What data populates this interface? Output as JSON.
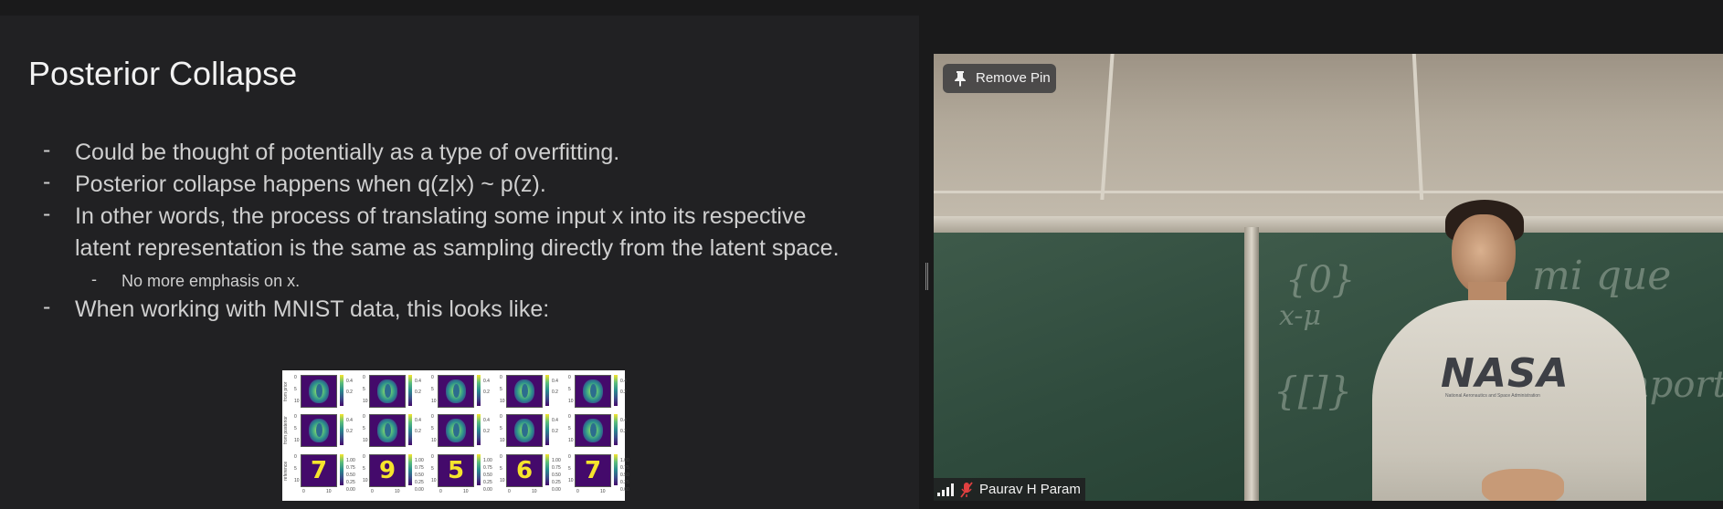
{
  "slide": {
    "title": "Posterior Collapse",
    "bullets": [
      {
        "level": 1,
        "lines": [
          "Could be thought of potentially as a type of overfitting."
        ]
      },
      {
        "level": 1,
        "lines": [
          "Posterior collapse happens when q(z|x) ~ p(z)."
        ]
      },
      {
        "level": 1,
        "lines": [
          "In other words, the process of translating some input x into its respective",
          "latent representation is the same as sampling directly from the latent space."
        ]
      },
      {
        "level": 2,
        "lines": [
          "No more emphasis on x."
        ]
      },
      {
        "level": 1,
        "lines": [
          "When working with MNIST data, this looks like:"
        ]
      }
    ],
    "dash": "-",
    "figure": {
      "row_labels": [
        "from prior",
        "from posterior",
        "reference"
      ],
      "reference_digits": [
        "7",
        "9",
        "5",
        "6",
        "7"
      ],
      "colorbar_ticks_top": [
        "0.4",
        "0.2"
      ],
      "colorbar_ticks_ref": [
        "1.00",
        "0.75",
        "0.50",
        "0.25",
        "0.00"
      ],
      "axis_ticks_y": [
        "0",
        "5",
        "10"
      ],
      "axis_ticks_x": [
        "0",
        "10"
      ]
    }
  },
  "video": {
    "pin_button_label": "Remove Pin",
    "participant_name": "Paurav H Param",
    "shirt_text": "NASA",
    "shirt_subtext": "National Aeronautics and Space Administration",
    "pin_icon": "pin-icon",
    "signal_icon": "signal-strength-icon",
    "mic_icon": "mic-muted-icon",
    "colors": {
      "muted_mic": "#e04040",
      "accent": "#f2f2f2"
    }
  }
}
